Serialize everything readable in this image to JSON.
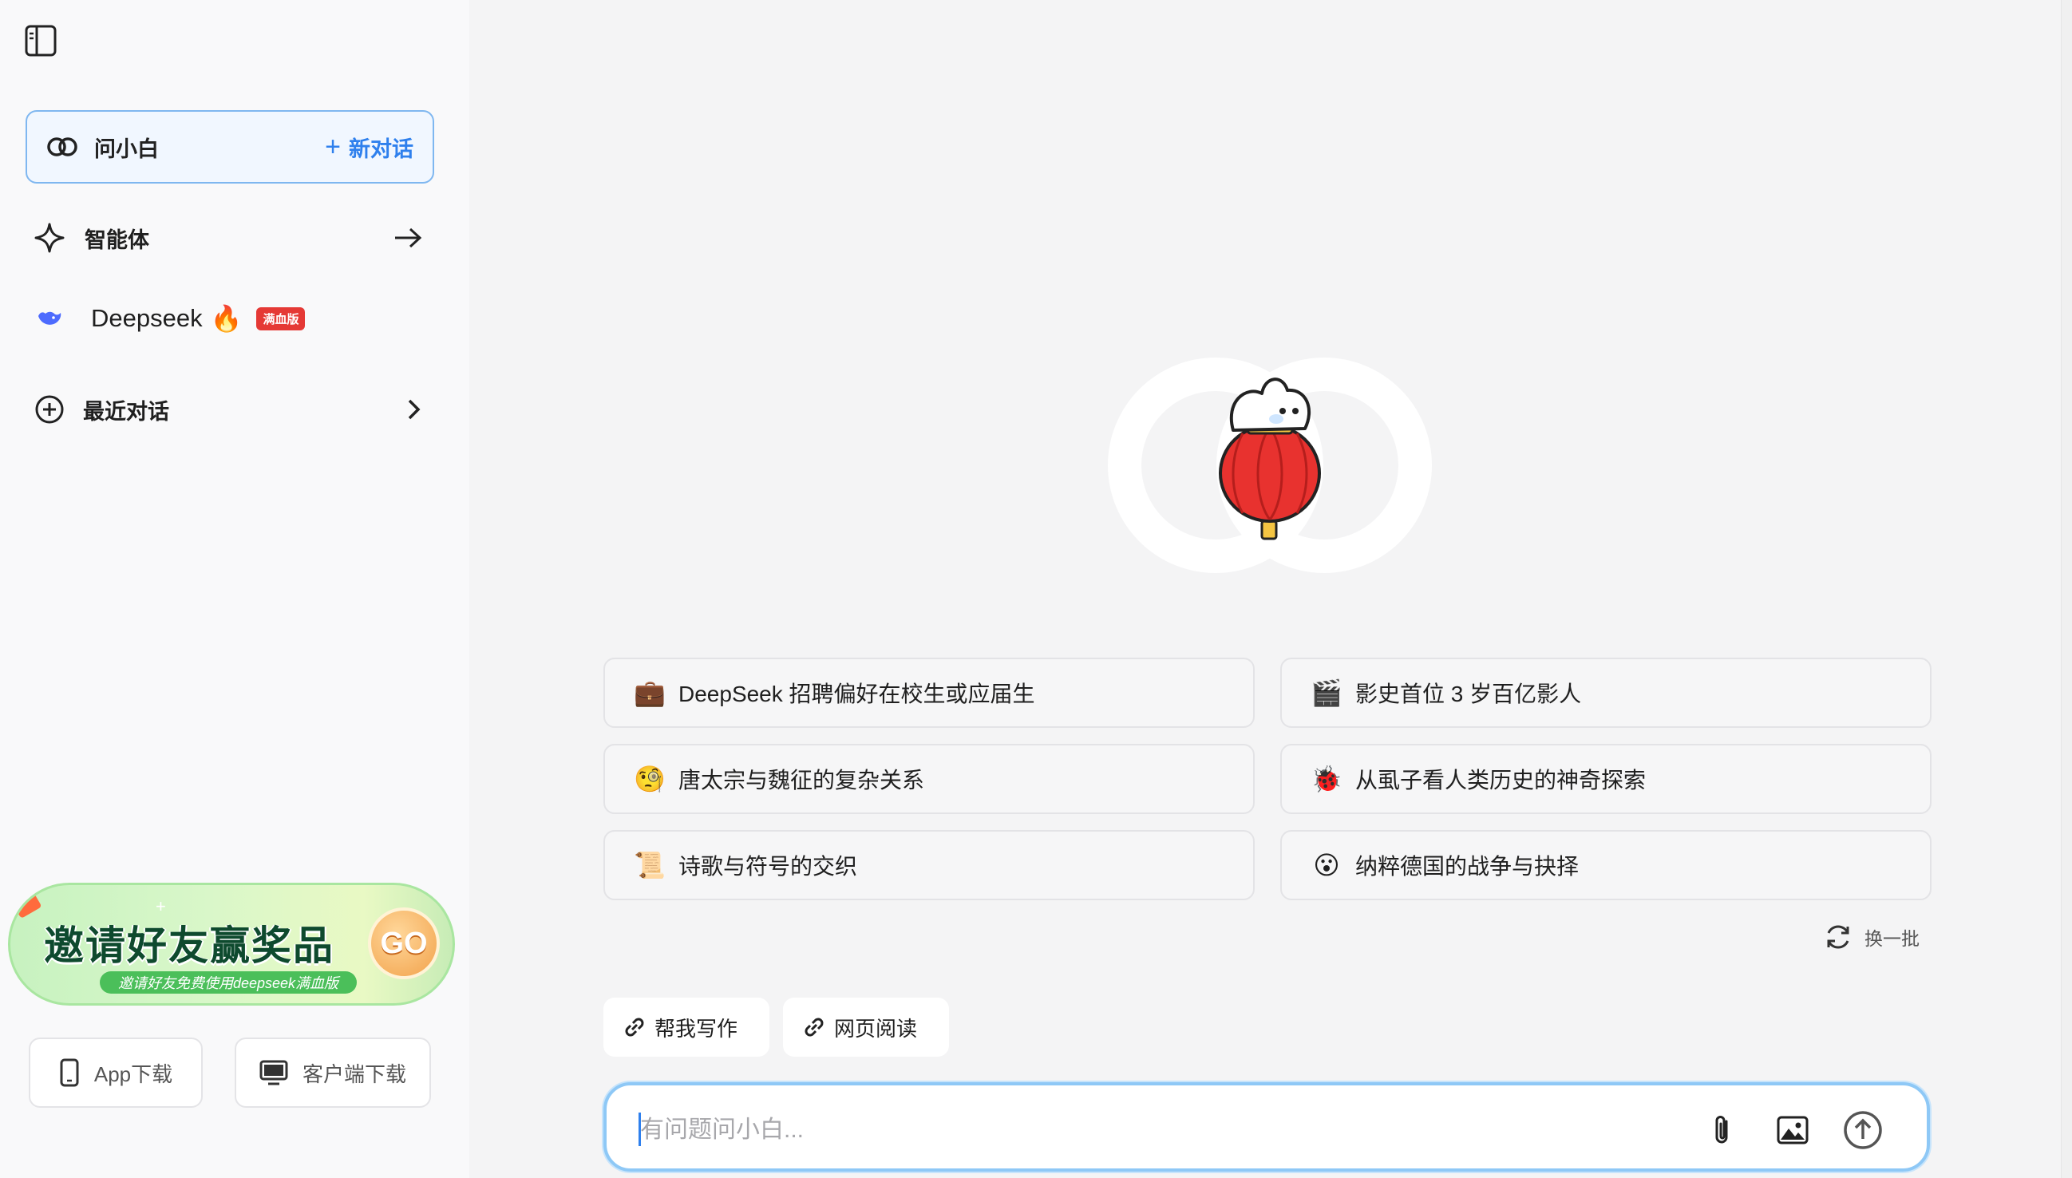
{
  "sidebar": {
    "toggle_icon": "sidebar-toggle-icon",
    "chat_entry": {
      "label": "问小白",
      "new_chat_label": "新对话"
    },
    "agents": {
      "label": "智能体"
    },
    "deepseek": {
      "label": "Deepseek",
      "fire": "🔥",
      "badge": "满血版"
    },
    "recent": {
      "label": "最近对话"
    },
    "promo": {
      "title": "邀请好友赢奖品",
      "subtitle": "邀请好友免费使用deepseek满血版",
      "go": "GO"
    },
    "downloads": {
      "app_label": "App下载",
      "client_label": "客户端下载"
    }
  },
  "main": {
    "suggestions": [
      {
        "emoji": "💼",
        "text": "DeepSeek 招聘偏好在校生或应届生"
      },
      {
        "emoji": "🎬",
        "text": "影史首位 3 岁百亿影人"
      },
      {
        "emoji": "🧐",
        "text": "唐太宗与魏征的复杂关系"
      },
      {
        "emoji": "🐞",
        "text": "从虱子看人类历史的神奇探索"
      },
      {
        "emoji": "📜",
        "text": "诗歌与符号的交织"
      },
      {
        "emoji": "😮",
        "text": "纳粹德国的战争与抉择"
      }
    ],
    "refresh_label": "换一批",
    "chips": [
      {
        "label": "帮我写作"
      },
      {
        "label": "网页阅读"
      }
    ],
    "input": {
      "placeholder": "有问题问小白...",
      "value": ""
    }
  },
  "colors": {
    "accent": "#2f80ed",
    "badge": "#e53935",
    "input_border": "#8ec8f6"
  }
}
